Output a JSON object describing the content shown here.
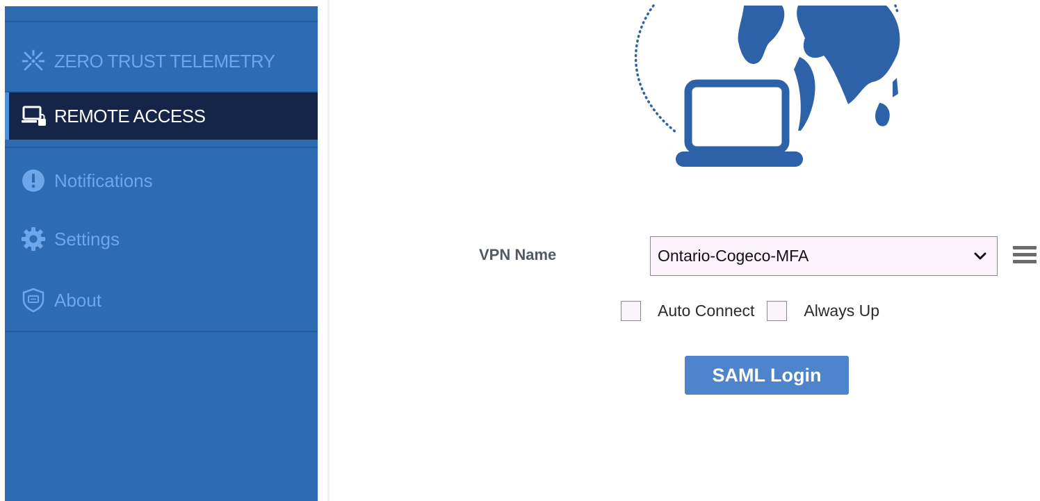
{
  "sidebar": {
    "items": [
      {
        "label": "ZERO TRUST TELEMETRY",
        "icon": "telemetry-icon",
        "active": false
      },
      {
        "label": "REMOTE ACCESS",
        "icon": "remote-access-icon",
        "active": true
      },
      {
        "label": "Notifications",
        "icon": "exclamation-icon",
        "active": false
      },
      {
        "label": "Settings",
        "icon": "gear-icon",
        "active": false
      },
      {
        "label": "About",
        "icon": "shield-icon",
        "active": false
      }
    ]
  },
  "illustration": {
    "icon": "globe-laptop-icon"
  },
  "form": {
    "vpn_label": "VPN Name",
    "vpn_selected": "Ontario-Cogeco-MFA",
    "auto_connect_label": "Auto Connect",
    "always_up_label": "Always Up",
    "auto_connect_checked": false,
    "always_up_checked": false,
    "login_button": "SAML Login"
  },
  "colors": {
    "sidebar": "#2d6bb2",
    "sidebar_active": "#142547",
    "sidebar_text": "#6ea6ea",
    "accent": "#4d84cb",
    "illustration": "#2d62a8"
  }
}
